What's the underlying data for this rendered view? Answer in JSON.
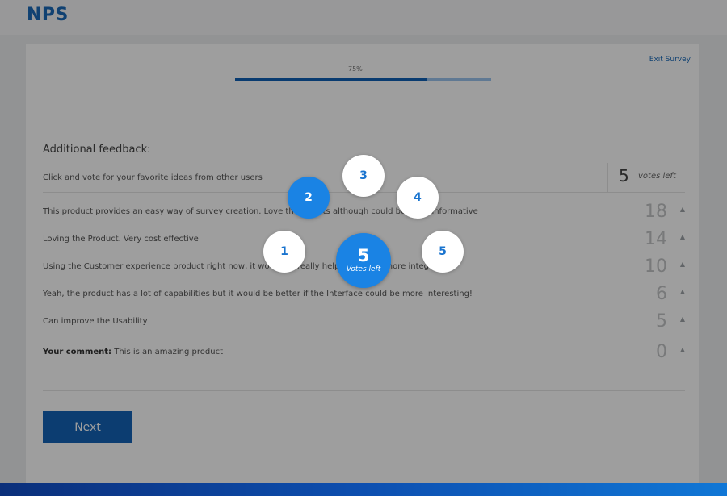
{
  "header": {
    "title": "NPS"
  },
  "survey": {
    "exit_label": "Exit Survey",
    "progress_label": "75%",
    "progress_fraction": 0.75
  },
  "feedback": {
    "title": "Additional feedback:",
    "instruction": "Click and vote for your favorite ideas from other users",
    "votes_count": "5",
    "votes_label": "votes left",
    "ideas": [
      {
        "text": "This product provides an easy way of survey creation. Love the reports although could be more informative",
        "count": "18"
      },
      {
        "text": "Loving the Product. Very cost effective",
        "count": "14"
      },
      {
        "text": "Using the Customer experience product right now, it would be really helpful if it has more integrations",
        "count": "10"
      },
      {
        "text": "Yeah, the product has a lot of capabilities but it would be better if the Interface could be more interesting!",
        "count": "6"
      },
      {
        "text": "Can improve the Usability",
        "count": "5"
      }
    ],
    "comment": {
      "label": "Your comment:",
      "text": " This is an amazing product",
      "count": "0"
    },
    "upvote_icon": "triangle-up-icon"
  },
  "next_label": "Next",
  "vote_picker": {
    "options": [
      "1",
      "2",
      "3",
      "4",
      "5"
    ],
    "selected": "2",
    "center_value": "5",
    "center_label": "Votes left"
  },
  "colors": {
    "accent": "#1a74cf",
    "button": "#1463b7",
    "active_bubble": "#1a83e4"
  }
}
